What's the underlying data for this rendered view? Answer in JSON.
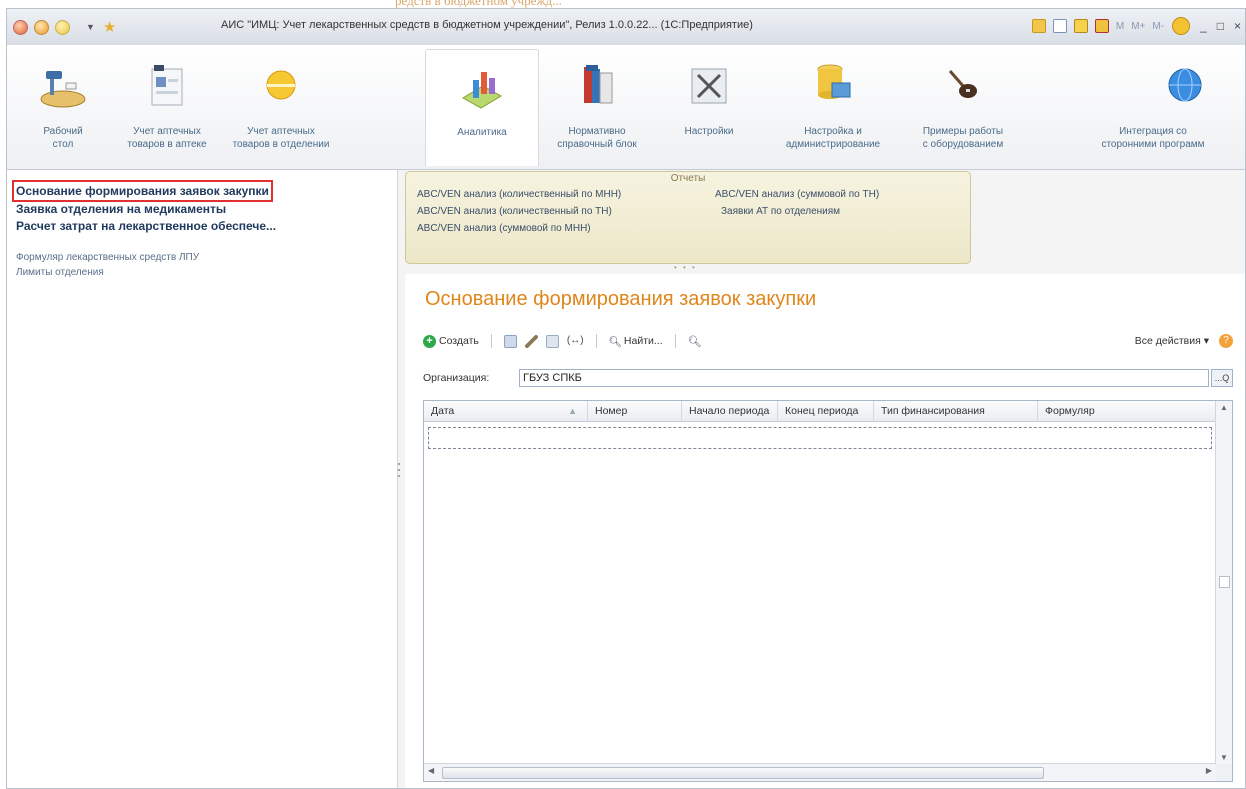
{
  "caption_fragment": "редств в бюджетном учрежд...",
  "window": {
    "title": "АИС \"ИМЦ: Учет лекарственных средств в бюджетном учреждении\", Релиз 1.0.0.22... (1С:Предприятие)",
    "controls": [
      "_",
      "□",
      "×"
    ],
    "mem_buttons": [
      "M",
      "M+",
      "M-"
    ]
  },
  "sections": [
    {
      "label": "Рабочий\nстол",
      "icon": "desk-icon"
    },
    {
      "label": "Учет аптечных\nтоваров в аптеке",
      "icon": "pharmacy-ledger-icon"
    },
    {
      "label": "Учет аптечных\nтоваров в отделении",
      "icon": "department-ledger-icon"
    },
    {
      "label": "Аналитика",
      "icon": "analytics-chart-icon",
      "active": true
    },
    {
      "label": "Нормативно\nсправочный блок",
      "icon": "books-icon"
    },
    {
      "label": "Настройки",
      "icon": "settings-icon"
    },
    {
      "label": "Настройка и\nадминистрирование",
      "icon": "database-icon"
    },
    {
      "label": "Примеры работы\nс оборудованием",
      "icon": "scanner-icon"
    },
    {
      "label": "Интеграция со\nсторонними программ",
      "icon": "globe-icon"
    }
  ],
  "nav": {
    "primary": [
      "Основание формирования заявок закупки",
      "Заявка отделения на медикаменты",
      "Расчет затрат на лекарственное обеспече..."
    ],
    "secondary": [
      "Формуляр лекарственных средств ЛПУ",
      "Лимиты отделения"
    ]
  },
  "reports": {
    "header": "Отчеты",
    "left": [
      "ABC/VEN анализ (количественный по МНН)",
      "ABC/VEN анализ (количественный по ТН)",
      "ABC/VEN анализ (суммовой по МНН)"
    ],
    "right": [
      "ABC/VEN анализ (суммовой по ТН)",
      "Заявки АТ по отделениям"
    ]
  },
  "form": {
    "title": "Основание формирования заявок закупки",
    "toolbar": {
      "create": "Создать",
      "find": "Найти...",
      "hierarchy": "(↔)",
      "all_actions": "Все действия ▾",
      "help": "?"
    },
    "org_label": "Организация:",
    "org_value": "ГБУЗ СПКБ",
    "org_button": "...Q",
    "columns": [
      "Дата",
      "Номер",
      "Начало периода",
      "Конец периода",
      "Тип финансирования",
      "Формуляр"
    ],
    "sort_mark": "▲"
  },
  "colors": {
    "accent_orange": "#e0861a",
    "nav_text": "#223a5e",
    "selection_outline": "#e03030",
    "reports_bg": "#f1ecd4"
  }
}
